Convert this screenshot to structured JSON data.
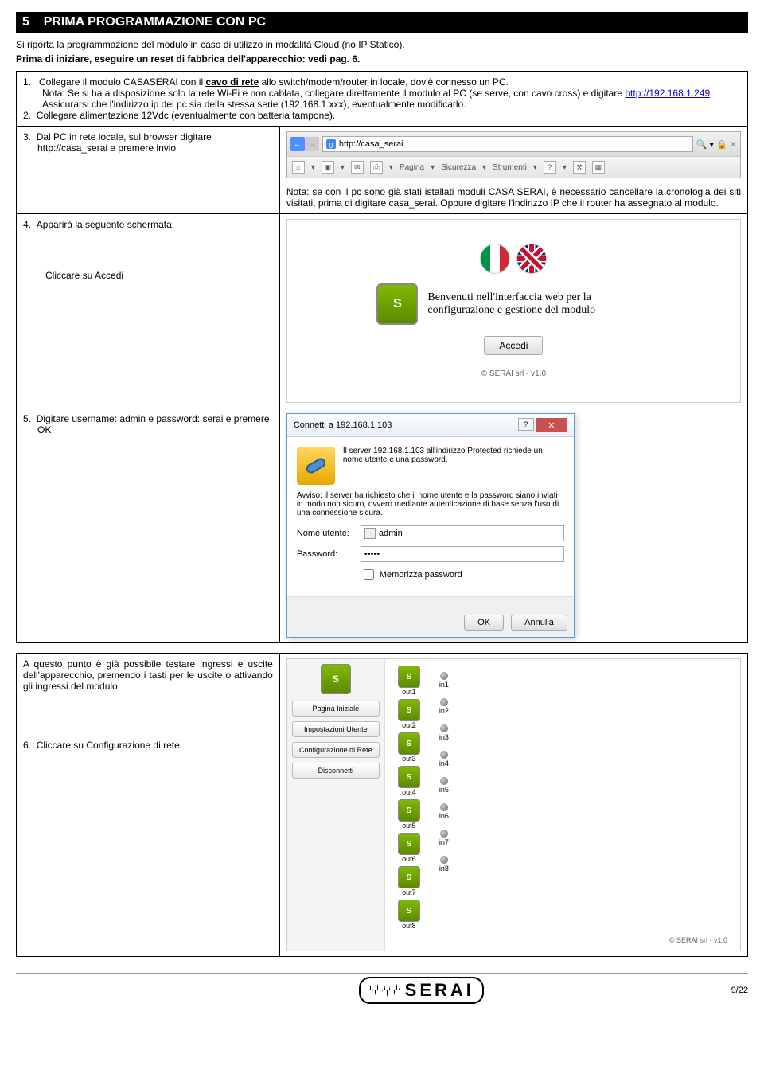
{
  "section": {
    "number": "5",
    "title": "PRIMA PROGRAMMAZIONE CON PC"
  },
  "intro": "Si riporta la programmazione del modulo in caso di utilizzo in modalità Cloud (no IP Statico).",
  "note_reset": "Prima di iniziare, eseguire un reset di fabbrica dell'apparecchio: vedi pag. 6.",
  "step1": {
    "pre": "Collegare il modulo CASASERAI con il ",
    "underline": "cavo di rete",
    "post": " allo switch/modem/router in locale, dov'è connesso un PC.",
    "nota_pre": "Nota: Se si ha a disposizione solo la rete Wi-Fi e non cablata, collegare direttamente il modulo al PC (se serve, con cavo cross) e digitare ",
    "link": "http://192.168.1.249",
    "nota_post": ". Assicurarsi che l'indirizzo ip del pc sia della stessa serie (192.168.1.xxx), eventualmente modificarlo."
  },
  "step2": "Collegare alimentazione 12Vdc (eventualmente con batteria tampone).",
  "step3": {
    "text": "Dal PC in rete locale, sul browser digitare http://casa_serai e premere invio",
    "url": "http://casa_serai",
    "toolbar_items": [
      "Pagina",
      "Sicurezza",
      "Strumenti"
    ],
    "nota": "Nota: se con il pc sono già stati istallati moduli CASA SERAI, è necessario cancellare la cronologia dei siti visitati, prima di digitare casa_serai. Oppure digitare l'indirizzo IP che il router ha assegnato al modulo."
  },
  "step4": {
    "label": "Apparirà la seguente schermata:",
    "click": "Cliccare su Accedi",
    "welcome": "Benvenuti nell'interfaccia web per la configurazione e gestione del modulo",
    "button": "Accedi",
    "copyright": "© SERAI srl - v1.0"
  },
  "step5": {
    "label": "Digitare username: admin e password: serai e premere OK",
    "dialog_title": "Connetti a 192.168.1.103",
    "dialog_text1": "Il server 192.168.1.103 all'indirizzo Protected richiede un nome utente e una password.",
    "dialog_text2": "Avviso: il server ha richiesto che il nome utente e la password siano inviati in modo non sicuro, ovvero mediante autenticazione di base senza l'uso di una connessione sicura.",
    "user_label": "Nome utente:",
    "user_value": "admin",
    "pass_label": "Password:",
    "pass_value": "•••••",
    "remember": "Memorizza password",
    "ok": "OK",
    "cancel": "Annulla"
  },
  "outro": {
    "text": "A questo punto è già possibile testare ingressi e uscite dell'apparecchio, premendo i tasti per le uscite o attivando gli ingressi del modulo.",
    "step6": "Cliccare su Configurazione di rete",
    "sidebar": [
      "Pagina Iniziale",
      "Impostazioni Utente",
      "Configurazione di Rete",
      "Disconnetti"
    ],
    "outs": [
      "out1",
      "out2",
      "out3",
      "out4",
      "out5",
      "out6",
      "out7",
      "out8"
    ],
    "ins": [
      "in1",
      "in2",
      "in3",
      "in4",
      "in5",
      "in6",
      "in7",
      "in8"
    ],
    "copyright": "© SERAI srl - v1.0"
  },
  "footer": {
    "brand": "SERAI",
    "page": "9/22"
  }
}
